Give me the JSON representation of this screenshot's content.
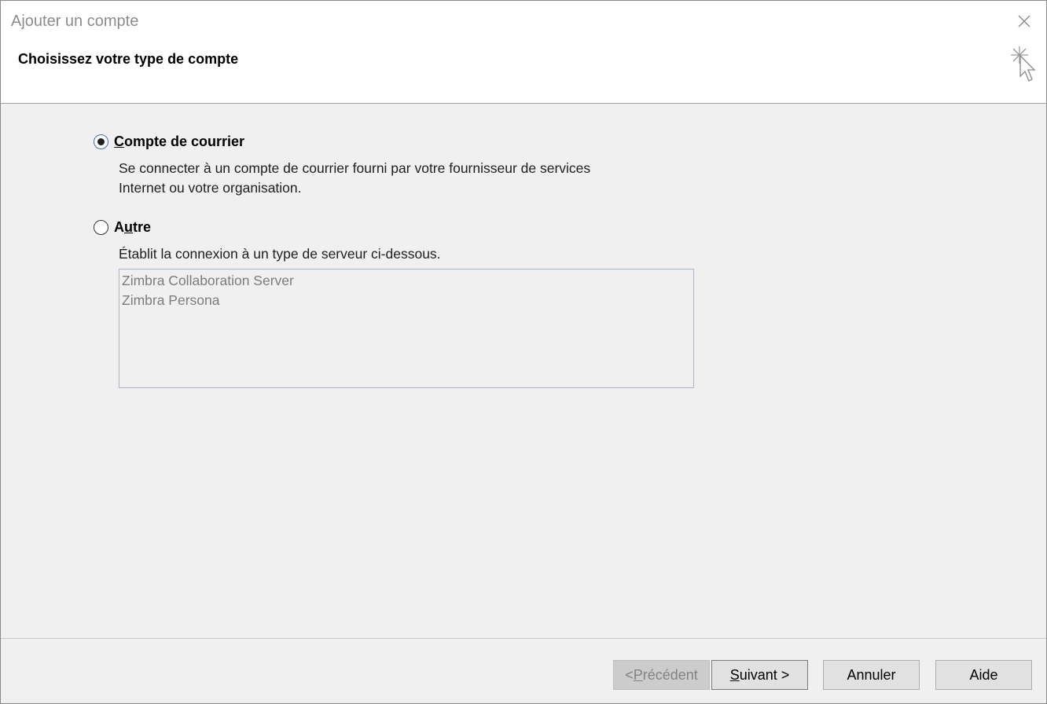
{
  "window": {
    "title": "Ajouter un compte"
  },
  "header": {
    "title": "Choisissez votre type de compte"
  },
  "options": {
    "mail": {
      "label_accel": "C",
      "label_rest": "ompte de courrier",
      "checked": true,
      "description_line1": "Se connecter à un compte de courrier fourni par votre fournisseur de services",
      "description_line2": "Internet ou votre organisation."
    },
    "other": {
      "label_pre": "A",
      "label_accel": "u",
      "label_rest": "tre",
      "checked": false,
      "description": "Établit la connexion à un type de serveur ci-dessous.",
      "server_types": [
        "Zimbra Collaboration Server",
        "Zimbra Persona"
      ]
    }
  },
  "footer": {
    "back": {
      "pre": "< ",
      "accel": "P",
      "rest": "récédent",
      "enabled": false
    },
    "next": {
      "accel": "S",
      "rest": "uivant >",
      "enabled": true
    },
    "cancel": {
      "label": "Annuler"
    },
    "help": {
      "label": "Aide"
    }
  },
  "colors": {
    "dialog_bg": "#f0f0f0",
    "header_bg": "#ffffff",
    "button_bg": "#e1e1e1",
    "disabled_text": "#838383"
  },
  "icons": {
    "close": "close-icon",
    "wizard": "wizard-cursor-icon"
  }
}
